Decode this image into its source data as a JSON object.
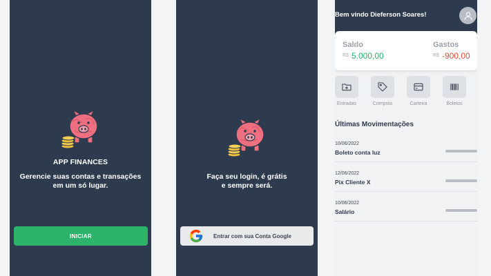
{
  "screen_intro": {
    "app_name": "APP FINANCES",
    "subtitle_line1": "Gerencie suas contas e transações",
    "subtitle_line2": "em um só lugar.",
    "start_button": "INICIAR"
  },
  "screen_login": {
    "subtitle_line1": "Faça seu login, é grátis",
    "subtitle_line2": "e sempre será.",
    "google_button": "Entrar com sua Conta Google"
  },
  "screen_home": {
    "welcome": "Bem vindo Dieferson Soares!",
    "balance": {
      "saldo_label": "Saldo",
      "saldo_currency": "R$",
      "saldo_value": "5.000,00",
      "gastos_label": "Gastos",
      "gastos_currency": "R$",
      "gastos_value": "-900,00",
      "positive_color": "#2db36a",
      "negative_color": "#e74c3c"
    },
    "actions": [
      {
        "label": "Entradas",
        "icon": "folder-plus-icon"
      },
      {
        "label": "Compras",
        "icon": "tag-icon"
      },
      {
        "label": "Carteira",
        "icon": "credit-card-icon"
      },
      {
        "label": "Boletos",
        "icon": "barcode-icon"
      }
    ],
    "section_title": "Últimas Movimentações",
    "movements": [
      {
        "date": "10/06/2022",
        "description": "Boleto conta luz"
      },
      {
        "date": "12/06/2022",
        "description": "Pix Cliente X"
      },
      {
        "date": "10/06/2022",
        "description": "Salário"
      }
    ]
  },
  "colors": {
    "dark_bg": "#2e3b4e",
    "primary_green": "#2db36a",
    "piggy_pink": "#ee6f7f"
  }
}
